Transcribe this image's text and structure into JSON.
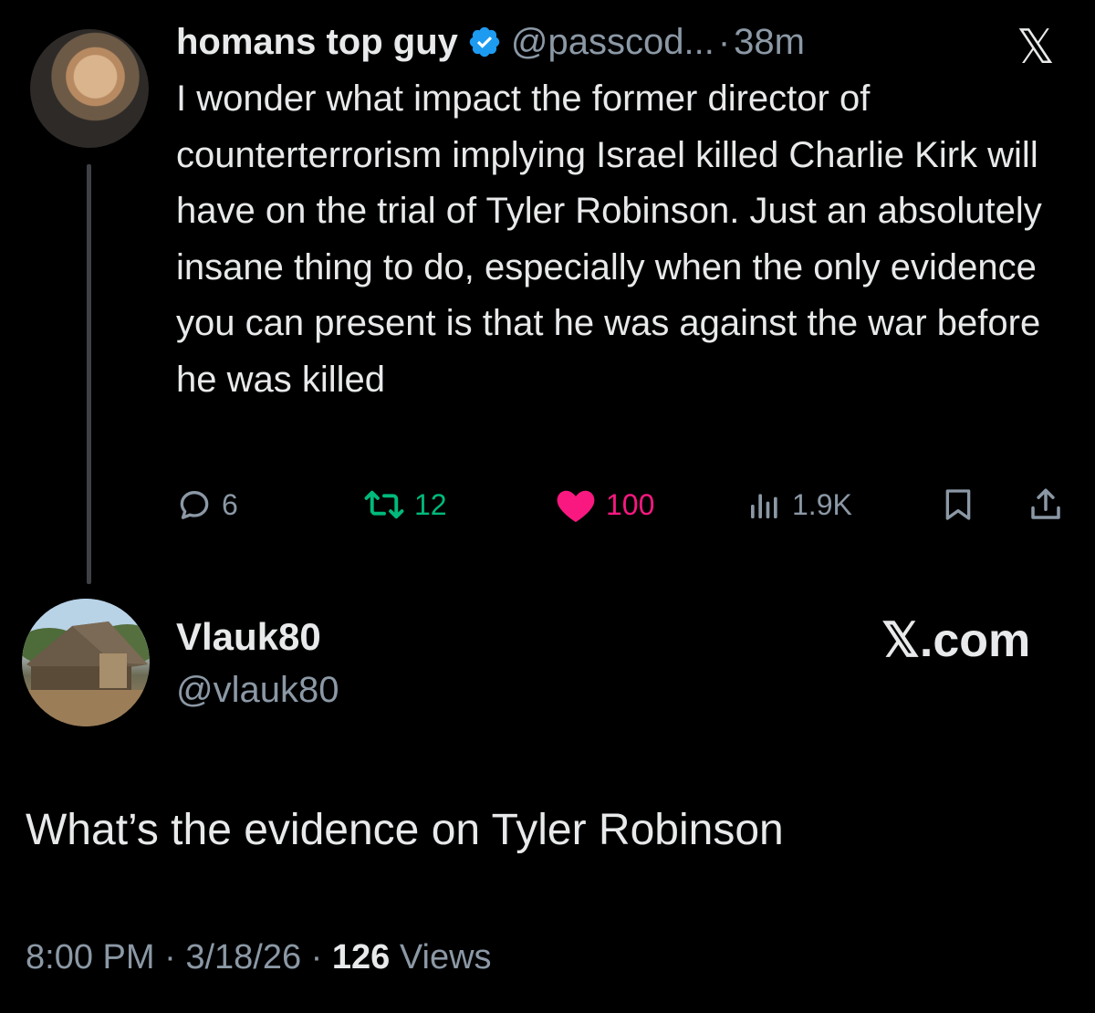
{
  "tweet": {
    "author_name": "homans top guy",
    "handle": "@passcod...",
    "separator": "·",
    "time": "38m",
    "text": "I wonder what impact the former director of counterterrorism implying Israel killed Charlie Kirk will have on the trial of Tyler Robinson. Just an absolutely insane thing to do, especially when the only evidence you can present is that he was against the war before he was killed",
    "actions": {
      "replies": "6",
      "retweets": "12",
      "likes": "100",
      "views": "1.9K"
    }
  },
  "top_logo": "𝕏",
  "reply": {
    "author_name": "Vlauk80",
    "handle": "@vlauk80",
    "brand": "𝕏.com",
    "text": "What’s the evidence on Tyler Robinson",
    "meta": {
      "time": "8:00 PM",
      "sep": " · ",
      "date": "3/18/26",
      "view_count": "126",
      "views_label": "Views"
    }
  },
  "colors": {
    "background": "#000000",
    "text": "#e7e9ea",
    "muted": "#8b98a5",
    "retweet": "#00ba7c",
    "like": "#f91880",
    "verified": "#1d9bf0"
  },
  "icons": [
    "verified-badge-icon",
    "x-logo-icon",
    "reply-icon",
    "retweet-icon",
    "heart-icon",
    "views-icon",
    "bookmark-icon",
    "share-icon"
  ]
}
